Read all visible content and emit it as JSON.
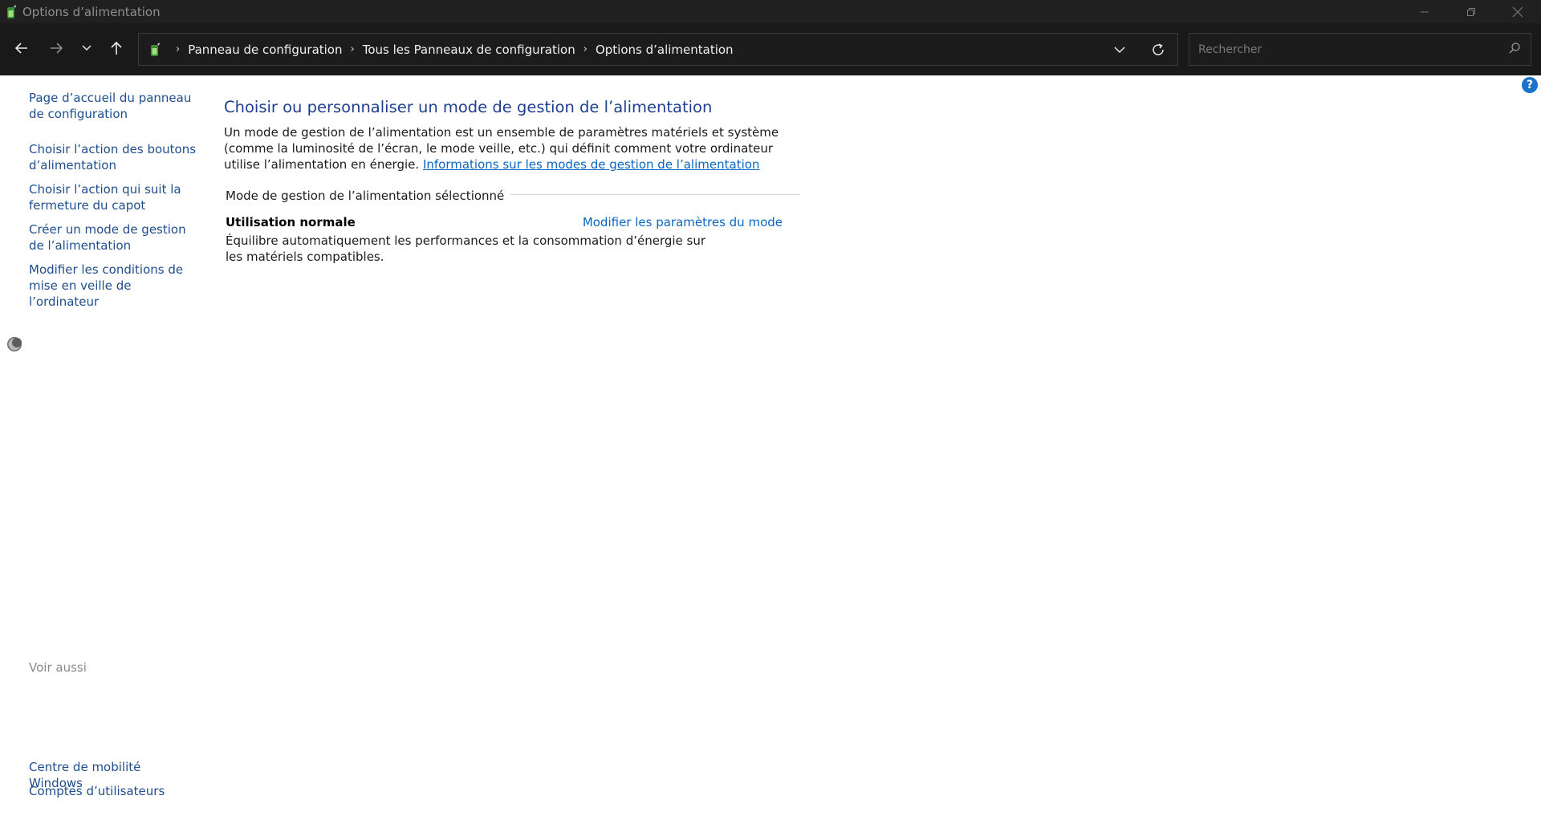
{
  "window": {
    "title": "Options d’alimentation"
  },
  "navbar": {
    "breadcrumbs": [
      "Panneau de configuration",
      "Tous les Panneaux de configuration",
      "Options d’alimentation"
    ],
    "search_placeholder": "Rechercher"
  },
  "sidebar": {
    "links": [
      "Page d’accueil du panneau de configuration",
      "Choisir l’action des boutons d’alimentation",
      "Choisir l’action qui suit la fermeture du capot",
      "Créer un mode de gestion de l’alimentation",
      "Modifier les conditions de mise en veille de l’ordinateur"
    ],
    "see_also_title": "Voir aussi",
    "see_also": [
      "Centre de mobilité Windows",
      "Comptes d’utilisateurs"
    ]
  },
  "main": {
    "heading": "Choisir ou personnaliser un mode de gestion de l’alimentation",
    "description": "Un mode de gestion de l’alimentation est un ensemble de paramètres matériels et système (comme la luminosité de l’écran, le mode veille, etc.) qui définit comment votre ordinateur utilise l’alimentation en énergie.",
    "info_link": "Informations sur les modes de gestion de l’alimentation",
    "group_label": "Mode de gestion de l’alimentation sélectionné",
    "plan": {
      "name": "Utilisation normale",
      "edit_link": "Modifier les paramètres du mode",
      "description": "Équilibre automatiquement les performances et la consommation d’énergie sur les matériels compatibles."
    }
  },
  "colors": {
    "titlebar_bg": "#202020",
    "navbar_bg": "#191919",
    "link": "#1f4e8c",
    "heading": "#1e3f8f",
    "accent": "#0a66c2"
  }
}
